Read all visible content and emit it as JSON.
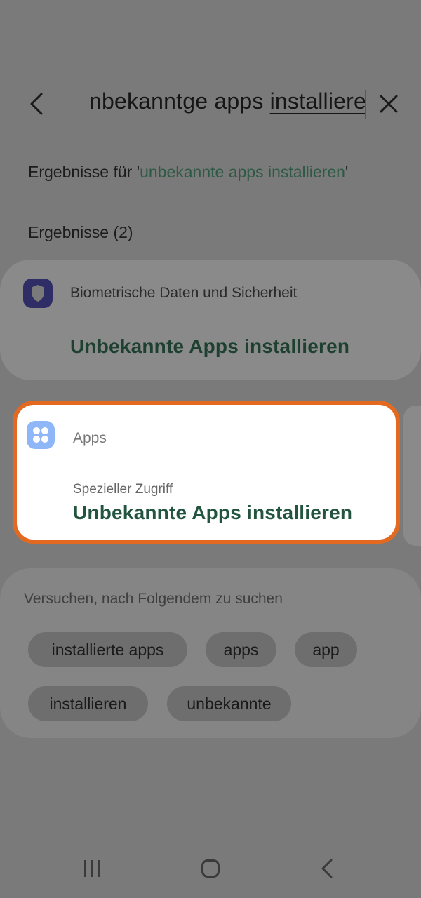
{
  "search": {
    "text_before": "nbekanntge apps ",
    "text_underlined": "installiere"
  },
  "results": {
    "prefix": "Ergebnisse für '",
    "query": "unbekannte apps installieren",
    "suffix": "'",
    "count_label": "Ergebnisse (2)"
  },
  "cards": [
    {
      "icon": "shield-icon",
      "category": "Biometrische Daten und Sicherheit",
      "title": "Unbekannte Apps installieren"
    },
    {
      "icon": "apps-grid-icon",
      "category": "Apps",
      "subtitle": "Spezieller Zugriff",
      "title": "Unbekannte Apps installieren",
      "highlighted": true
    }
  ],
  "suggestions": {
    "heading": "Versuchen, nach Folgendem zu suchen",
    "chips": [
      "installierte apps",
      "apps",
      "app",
      "installieren",
      "unbekannte"
    ]
  },
  "colors": {
    "highlight_border": "#e2691f",
    "accent_green": "#22543f",
    "shield_icon_bg": "#2f2d66",
    "apps_icon_bg": "#8fb6f6"
  }
}
